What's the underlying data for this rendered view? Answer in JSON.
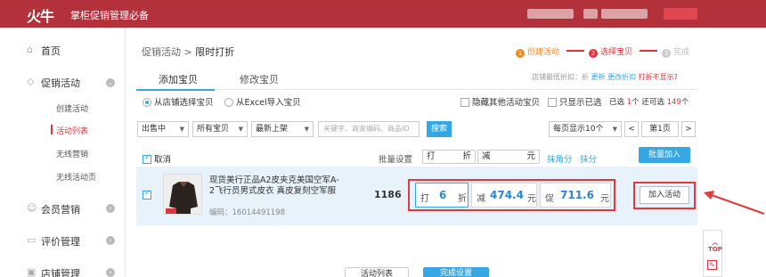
{
  "app": {
    "logo_text": "火牛",
    "title": "掌柜促销管理必备"
  },
  "sidebar": {
    "items": [
      {
        "label": "首页",
        "icon": "home-icon"
      },
      {
        "label": "促销活动",
        "icon": "tag-icon"
      },
      {
        "label": "会员营销",
        "icon": "user-icon"
      },
      {
        "label": "评价管理",
        "icon": "comment-icon"
      },
      {
        "label": "店铺管理",
        "icon": "shop-icon"
      }
    ],
    "sub_items": [
      {
        "label": "创建活动"
      },
      {
        "label": "活动列表"
      },
      {
        "label": "无线营销"
      },
      {
        "label": "无线活动页"
      }
    ]
  },
  "breadcrumb": {
    "parent": "促销活动",
    "separator": ">",
    "current": "限时打折"
  },
  "steps": [
    {
      "num": "1",
      "label": "创建活动",
      "color": "#f08a24"
    },
    {
      "num": "2",
      "label": "选择宝贝",
      "color": "#d9363e"
    },
    {
      "num": "3",
      "label": "完成",
      "color": "#cccccc"
    }
  ],
  "tabs": {
    "add": "添加宝贝",
    "edit": "修改宝贝"
  },
  "discount_info": {
    "prefix": "店铺最低折扣：折",
    "update": "更新",
    "change": "更改折扣",
    "not_shown": "打折不显示?"
  },
  "source_options": {
    "shop": "从店铺选择宝贝",
    "excel": "从Excel导入宝贝"
  },
  "filters": {
    "hide_others": "隐藏其他活动宝贝",
    "only_selected": "只显示已选",
    "selected_prefix": "已选",
    "selected_count": "1",
    "selected_suffix": "个",
    "remaining_prefix": "还可选",
    "remaining_count": "149",
    "remaining_suffix": "个"
  },
  "toolbar": {
    "status_select": "出售中",
    "category_select": "所有宝贝",
    "sort_select": "最新上架",
    "search_placeholder": "关键字、商家编码、商品ID",
    "search_button": "搜索",
    "page_size": "每页显示10个",
    "prev": "<",
    "page": "第1页",
    "next": ">"
  },
  "table_header": {
    "cancel": "取消",
    "batch_set": "批量设置",
    "da": "打",
    "zhe": "折",
    "jian": "减",
    "yuan": "元",
    "round_jiao": "抹角分",
    "round_fen": "抹分",
    "bulk_add": "批量加入"
  },
  "product": {
    "title": "现货美行正品A2皮夹克美国空军A-2飞行员男式皮衣 真皮复刻空军服",
    "code": "编码：16014491198",
    "stock": "1186",
    "discount_label": "打",
    "discount_value": "6",
    "discount_unit": "折",
    "reduce_label": "减",
    "reduce_value": "474.4",
    "reduce_unit": "元",
    "promo_label": "促",
    "promo_value": "711.6",
    "promo_unit": "元",
    "join_button": "加入活动"
  },
  "side_tools": {
    "top": "TOP"
  },
  "bottom_buttons": {
    "prev": "活动列表",
    "next": "完成设置"
  },
  "colors": {
    "brand": "#b3313a",
    "accent": "#35a7e3",
    "highlight": "#e23a3a"
  }
}
